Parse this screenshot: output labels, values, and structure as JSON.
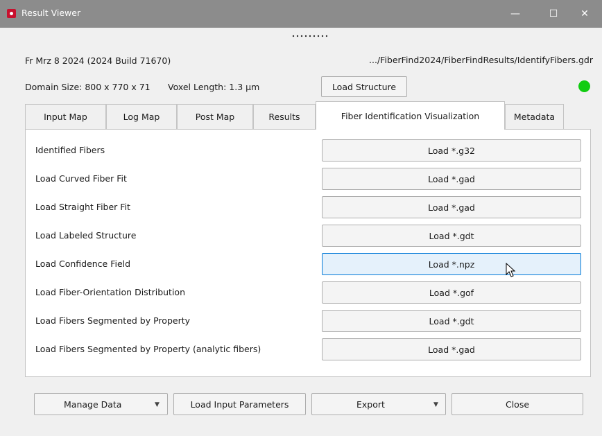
{
  "window": {
    "title": "Result Viewer",
    "controls": {
      "minimize": "—",
      "maximize": "☐",
      "close": "✕"
    }
  },
  "header": {
    "date_build": "Fr Mrz 8 2024 (2024 Build 71670)",
    "path": ".../FiberFind2024/FiberFindResults/IdentifyFibers.gdr",
    "domain_size": "Domain Size: 800 x 770 x 71",
    "voxel_length": "Voxel Length: 1.3 µm",
    "load_structure": "Load Structure",
    "status_color": "#11cc11"
  },
  "tabs": [
    {
      "label": "Input Map",
      "active": false
    },
    {
      "label": "Log Map",
      "active": false
    },
    {
      "label": "Post Map",
      "active": false
    },
    {
      "label": "Results",
      "active": false
    },
    {
      "label": "Fiber Identification Visualization",
      "active": true
    },
    {
      "label": "Metadata",
      "active": false
    }
  ],
  "rows": [
    {
      "label": "Identified Fibers",
      "button": "Load *.g32"
    },
    {
      "label": "Load Curved Fiber Fit",
      "button": "Load *.gad"
    },
    {
      "label": "Load Straight Fiber Fit",
      "button": "Load *.gad"
    },
    {
      "label": "Load Labeled Structure",
      "button": "Load *.gdt"
    },
    {
      "label": "Load Confidence Field",
      "button": "Load *.npz"
    },
    {
      "label": "Load Fiber-Orientation Distribution",
      "button": "Load *.gof"
    },
    {
      "label": "Load Fibers Segmented by Property",
      "button": "Load *.gdt"
    },
    {
      "label": "Load Fibers Segmented by Property (analytic fibers)",
      "button": "Load *.gad"
    }
  ],
  "footer": {
    "manage_data": "Manage Data",
    "load_input_parameters": "Load Input Parameters",
    "export": "Export",
    "close": "Close"
  },
  "icons": {
    "dropdown": "▼"
  }
}
